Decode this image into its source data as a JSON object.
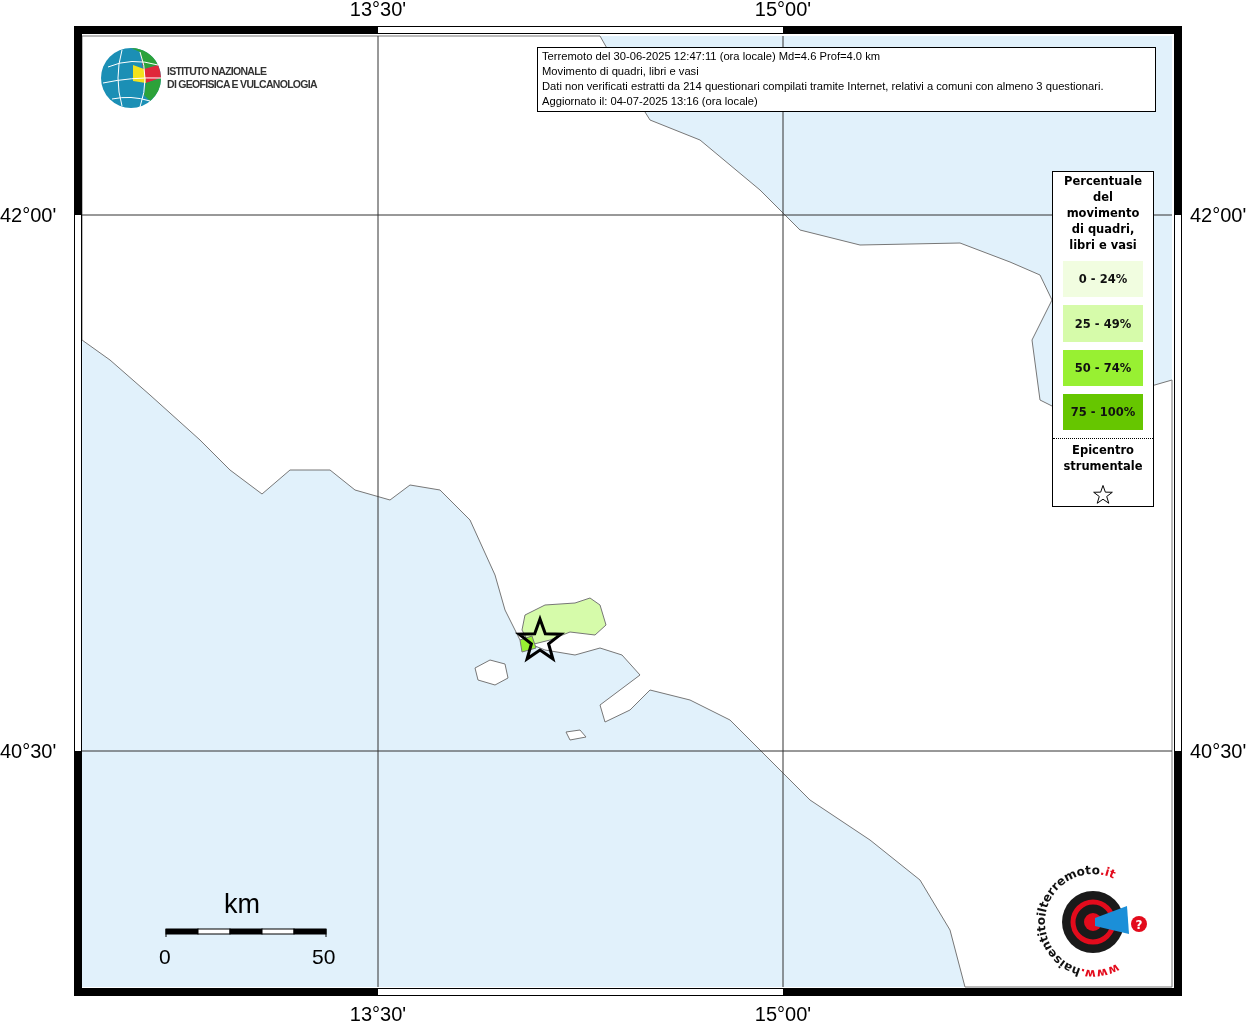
{
  "map": {
    "info_box": {
      "lines": [
        "Terremoto del 30-06-2025 12:47:11 (ora locale) Md=4.6 Prof=4.0 km",
        "Movimento di quadri, libri e vasi",
        "Dati non verificati estratti da 214 questionari compilati tramite Internet, relativi a comuni con almeno 3 questionari.",
        "Aggiornato il: 04-07-2025 13:16 (ora locale)"
      ]
    },
    "logo": {
      "lines": [
        "ISTITUTO NAZIONALE",
        "DI GEOFISICA E VULCANOLOGIA"
      ]
    },
    "axis_labels": {
      "top": [
        "13°30'",
        "15°00'"
      ],
      "bottom": [
        "13°30'",
        "15°00'"
      ],
      "left": [
        "42°00'",
        "40°30'"
      ],
      "right": [
        "42°00'",
        "40°30'"
      ]
    },
    "legend": {
      "title": "Percentuale del movimento di quadri, libri e vasi",
      "classes": [
        {
          "label": "0 - 24%",
          "color": "#f1fde0"
        },
        {
          "label": "25 - 49%",
          "color": "#d6fbaa"
        },
        {
          "label": "50 - 74%",
          "color": "#98f032"
        },
        {
          "label": "75 - 100%",
          "color": "#66c600"
        }
      ],
      "epicenter_label": "Epicentro strumentale"
    },
    "scale_bar": {
      "unit": "km",
      "start": "0",
      "end": "50"
    },
    "badge": {
      "prefix": "www.",
      "name": "haisentitoilterremoto",
      "suffix": ".it",
      "question": "?"
    }
  }
}
